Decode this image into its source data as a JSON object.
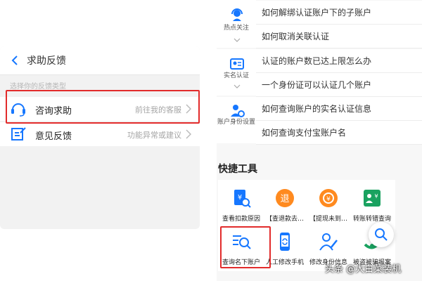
{
  "left": {
    "title": "求助反馈",
    "section_label": "选择你的反馈类型",
    "options": [
      {
        "label": "咨询求助",
        "hint": "前往我的客服"
      },
      {
        "label": "意见反馈",
        "hint": "功能异常或建议"
      }
    ]
  },
  "right": {
    "categories": [
      {
        "label": "热点关注",
        "questions": [
          "如何解绑认证账户下的子账户",
          "如何取消关联认证"
        ]
      },
      {
        "label": "实名认证",
        "questions": [
          "认证的账户数已达上限怎么办",
          "一个身份证可以认证几个账户"
        ]
      },
      {
        "label": "账户身份设置",
        "questions": [
          "如何查询账户的实名认证信息",
          "如何查询支付宝账户名"
        ]
      }
    ],
    "tools_title": "快捷工具",
    "tools": [
      {
        "label": "查看扣款原因",
        "icon": "deduction-search-icon"
      },
      {
        "label": "【查退款去…",
        "icon": "refund-icon"
      },
      {
        "label": "【提现未到…",
        "icon": "withdraw-icon"
      },
      {
        "label": "转账转错查询",
        "icon": "transfer-icon"
      },
      {
        "label": "查询名下账户",
        "icon": "account-search-icon"
      },
      {
        "label": "人工修改手机",
        "icon": "phone-change-icon"
      },
      {
        "label": "修改身份信息",
        "icon": "identity-edit-icon"
      },
      {
        "label": "被盗被骗报案",
        "icon": "report-icon"
      }
    ]
  },
  "watermark": "头条 @大白菜装机",
  "colors": {
    "accent_blue": "#1677ff",
    "highlight_red": "#e22b2b",
    "orange": "#ff8a1f",
    "green": "#1aa260"
  }
}
